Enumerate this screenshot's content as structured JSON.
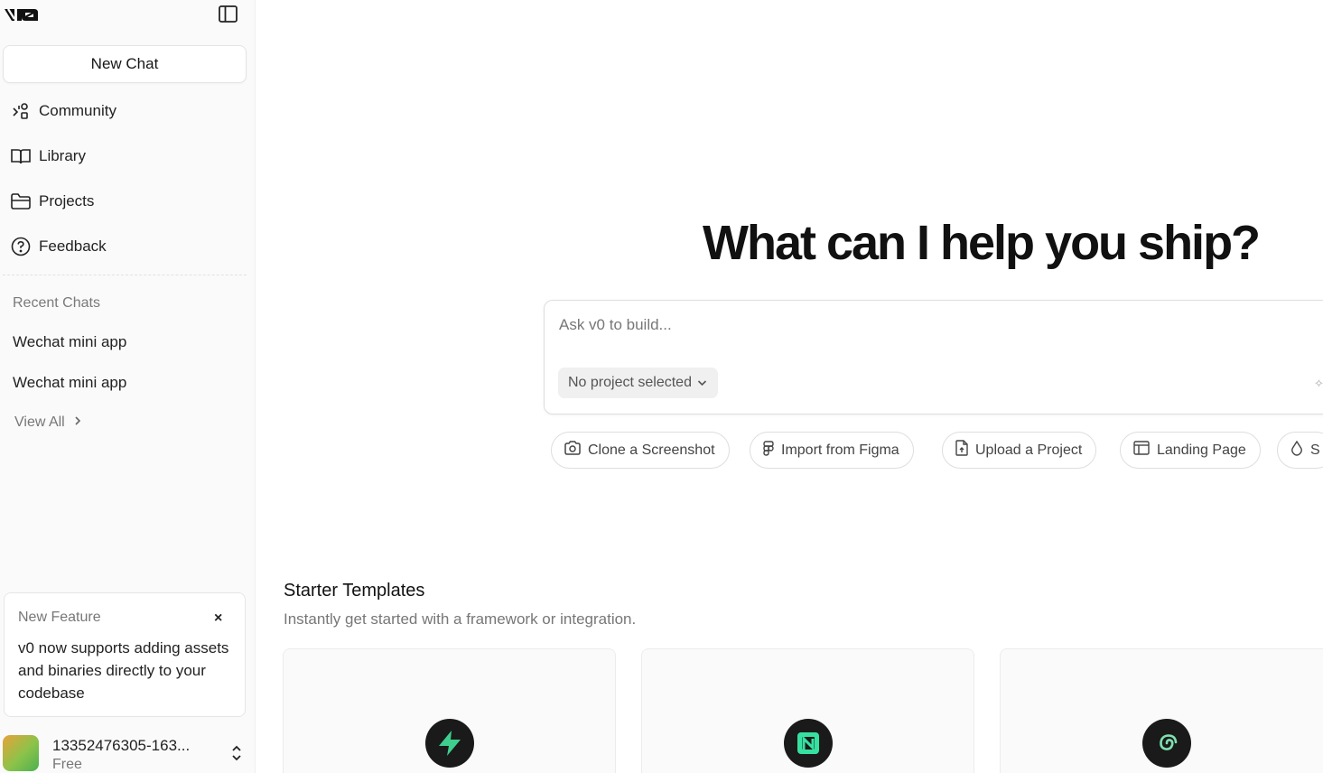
{
  "sidebar": {
    "new_chat_label": "New Chat",
    "nav": [
      {
        "label": "Community",
        "icon": "community-icon"
      },
      {
        "label": "Library",
        "icon": "book-icon"
      },
      {
        "label": "Projects",
        "icon": "folder-icon"
      },
      {
        "label": "Feedback",
        "icon": "help-circle-icon"
      }
    ],
    "recent_title": "Recent Chats",
    "recent": [
      "Wechat mini app",
      "Wechat mini app"
    ],
    "view_all": "View All"
  },
  "feature_card": {
    "title": "New Feature",
    "close": "×",
    "body": "v0 now supports adding assets and binaries directly to your codebase"
  },
  "account": {
    "name": "13352476305-163...",
    "plan": "Free"
  },
  "main": {
    "hero": "What can I help you ship?",
    "prompt_placeholder": "Ask v0 to build...",
    "project_select": "No project selected",
    "chips": [
      {
        "label": "Clone a Screenshot",
        "icon": "camera-icon"
      },
      {
        "label": "Import from Figma",
        "icon": "figma-icon"
      },
      {
        "label": "Upload a Project",
        "icon": "file-upload-icon"
      },
      {
        "label": "Landing Page",
        "icon": "layout-icon"
      },
      {
        "label": "S",
        "icon": "droplet-icon"
      }
    ],
    "starter_title": "Starter Templates",
    "starter_subtitle": "Instantly get started with a framework or integration.",
    "templates": [
      {
        "icon": "supabase-icon",
        "color": "#3ecf8e"
      },
      {
        "icon": "neon-icon",
        "color": "#37e0a1"
      },
      {
        "icon": "spiral-icon",
        "color": "#7ee0b0"
      }
    ]
  }
}
